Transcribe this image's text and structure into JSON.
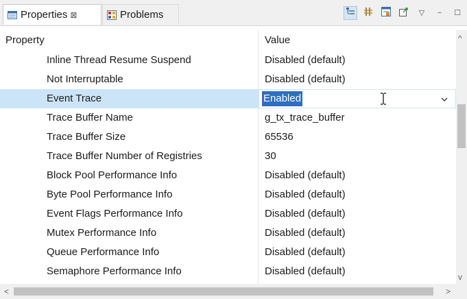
{
  "tabs": [
    {
      "label": "Properties",
      "close_glyph": "⊠",
      "icon": "properties-icon",
      "active": true
    },
    {
      "label": "Problems",
      "icon": "problems-icon",
      "active": false
    }
  ],
  "toolbar": {
    "buttons": [
      {
        "icon": "show-categories-icon",
        "pressed": true
      },
      {
        "icon": "show-advanced-icon",
        "pressed": false
      },
      {
        "icon": "filter-icon",
        "pressed": false
      },
      {
        "icon": "restore-default-icon",
        "pressed": false
      },
      {
        "icon": "view-menu-icon",
        "glyph": "▽"
      },
      {
        "icon": "minimize-icon",
        "glyph": "−"
      },
      {
        "icon": "maximize-icon",
        "glyph": "☐"
      }
    ]
  },
  "table": {
    "headers": {
      "property": "Property",
      "value": "Value"
    },
    "rows": [
      {
        "property": "Inline Thread Resume Suspend",
        "value": "Disabled (default)"
      },
      {
        "property": "Not Interruptable",
        "value": "Disabled (default)"
      },
      {
        "property": "Event Trace",
        "value": "Enabled",
        "selected": true,
        "editing": true
      },
      {
        "property": "Trace Buffer Name",
        "value": "g_tx_trace_buffer"
      },
      {
        "property": "Trace Buffer Size",
        "value": "65536"
      },
      {
        "property": "Trace Buffer Number of Registries",
        "value": "30"
      },
      {
        "property": "Block Pool Performance Info",
        "value": "Disabled (default)"
      },
      {
        "property": "Byte Pool Performance Info",
        "value": "Disabled (default)"
      },
      {
        "property": "Event Flags Performance Info",
        "value": "Disabled (default)"
      },
      {
        "property": "Mutex Performance Info",
        "value": "Disabled (default)"
      },
      {
        "property": "Queue Performance Info",
        "value": "Disabled (default)"
      },
      {
        "property": "Semaphore Performance Info",
        "value": "Disabled (default)"
      }
    ]
  },
  "editor": {
    "arrow_icon": "chevron-down-icon",
    "cursor_icon": "text-cursor-icon"
  },
  "scrollbars": {
    "up": "^",
    "down": "v",
    "left": "<",
    "right": ">"
  },
  "colors": {
    "selection_row": "#cce4f7",
    "selection_text_bg": "#2f6fbf",
    "tabbar_bg": "#f0f0f0"
  }
}
